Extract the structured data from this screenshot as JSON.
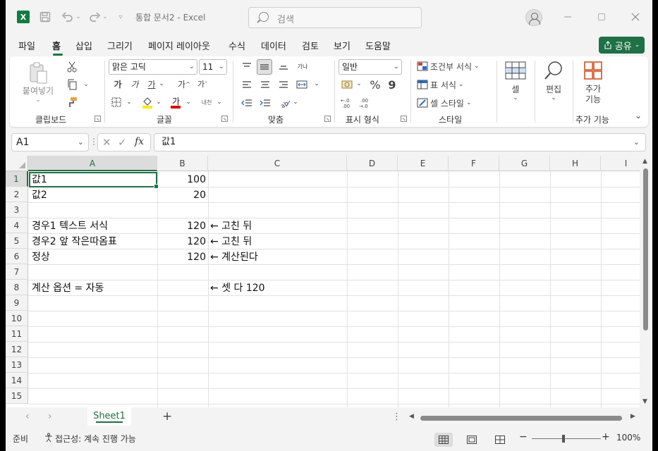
{
  "title_bar": {
    "doc_title": "통합 문서2  -  Excel",
    "search_placeholder": "검색",
    "app_icon": "X"
  },
  "ribbon_tabs": [
    "파일",
    "홈",
    "삽입",
    "그리기",
    "페이지 레이아웃",
    "수식",
    "데이터",
    "검토",
    "보기",
    "도움말"
  ],
  "share_label": "공유",
  "ribbon": {
    "clipboard": {
      "paste": "붙여넣기",
      "group": "클립보드"
    },
    "font": {
      "name": "맑은 고딕",
      "size": "11",
      "group": "글꼴",
      "bold": "가",
      "italic": "가",
      "underline": "가",
      "grow": "가",
      "shrink": "가",
      "phonetic": "내천"
    },
    "alignment": {
      "group": "맞춤",
      "wrap": "가나"
    },
    "number": {
      "format": "일반",
      "percent": "%",
      "comma": "9",
      "group": "표시 형식"
    },
    "styles": {
      "conditional": "조건부 서식",
      "table": "표 서식",
      "cell": "셀 스타일",
      "group": "스타일"
    },
    "cells": {
      "label": "셀"
    },
    "editing": {
      "label": "편집"
    },
    "addins": {
      "label": "추가\n기능",
      "group": "추가 기능"
    }
  },
  "formula_bar": {
    "name_box": "A1",
    "fx": "fx",
    "content": "값1"
  },
  "columns": [
    "A",
    "B",
    "C",
    "D",
    "E",
    "F",
    "G",
    "H",
    "I"
  ],
  "rows": [
    "1",
    "2",
    "3",
    "4",
    "5",
    "6",
    "7",
    "8",
    "9",
    "10",
    "11",
    "12",
    "13",
    "14",
    "15"
  ],
  "cells": {
    "A1": "값1",
    "B1": "100",
    "A2": "값2",
    "B2": "20",
    "A4": "경우1 텍스트 서식",
    "B4": "120",
    "C4": "← 고친 뒤",
    "A5": "경우2 앞 작은따옴표",
    "B5": "120",
    "C5": "← 고친 뒤",
    "A6": "정상",
    "B6": "120",
    "C6": "← 계산된다",
    "A8": "계산 옵션 = 자동",
    "C8": "← 셋 다 120"
  },
  "sheet_tabs": [
    "Sheet1"
  ],
  "add_sheet": "+",
  "status": {
    "ready": "준비",
    "accessibility": "접근성: 계속 진행 가능",
    "zoom": "100%",
    "zoom_minus": "−",
    "zoom_plus": "+"
  },
  "colors": {
    "accent": "#1e7145",
    "excel_green": "#107c41"
  }
}
